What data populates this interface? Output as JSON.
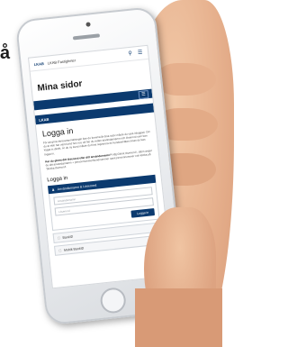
{
  "background": {
    "text": "å"
  },
  "header": {
    "brand": "LKAB",
    "title": "LKAB Fastigheter",
    "search_icon": "search-icon",
    "menu_icon": "menu-icon"
  },
  "page": {
    "title": "Mina sidor",
    "strip_label": "LKAB",
    "login_title": "Logga in",
    "intro": "För att göra intresseanmälningar kan du komma åt dina sidor måste du vara inloggad. Om du är ebb har varit kund hos oss så har du redan användarnamn och lösenord som kan logga in direkt. Är du ny kund måste du först registrera en kundanmälan innan du kan logga in.",
    "notice": "Har du glömt ditt lösenord eller ditt användarnamn?",
    "notice_rest": "Välj Glömt lösenord i, därin anger du ditt användarnamn + personnummer/kundnummer samt personnummer och klicka på 'Skicka lösenord'.",
    "sub_title": "Logga in",
    "accordion_label": "Användarnamn & Lösenord",
    "username_placeholder": "Användarnamn",
    "password_placeholder": "Lösenord",
    "login_button": "Logga in",
    "options": [
      "BankID",
      "Mobilt BankID"
    ]
  },
  "colors": {
    "brand": "#0b3a6f"
  }
}
